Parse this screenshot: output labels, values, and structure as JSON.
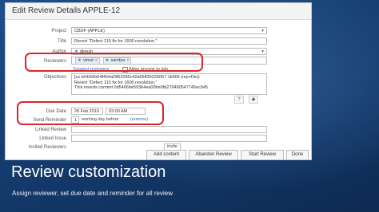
{
  "dialog": {
    "title": "Edit Review Details APPLE-12",
    "labels": {
      "project": "Project",
      "title": "Title",
      "author": "Author",
      "reviewers": "Reviewers",
      "objectives": "Objectives",
      "due_date": "Due Date",
      "send_reminder": "Send Reminder",
      "linked_review": "Linked Review",
      "linked_issue": "Linked Issue",
      "invited_reviewers": "Invited Reviewers"
    },
    "project_value": "CBDF (APPLE)",
    "title_value": "Revert \"Defect 115 fix for 1600 resolution.\"",
    "author_value": "dinesh",
    "reviewers": [
      "vimal",
      "sandya"
    ],
    "suggest_reviewers": "Suggest reviewers",
    "allow_anyone": "Allow anyone to join",
    "objectives_lines": [
      "[cs id=b55b64f464af3f62296c42a06ff39225067 1b506 |rep=Dio]:",
      "Revert \"Defect 115 fix for 1600 resolution.\"",
      "This reverts commit 0d5466be593b4ea00be0fd279490547745ec945"
    ],
    "due_date": "26 Feb 2019",
    "due_time": "03:00 AM",
    "reminder_count": "1",
    "reminder_text": "working day before",
    "reminder_remove": "(remove)",
    "invited_partial": "invite",
    "buttons": {
      "add_content": "Add content",
      "abandon_review": "Abandon Review",
      "start_review": "Start Review",
      "done": "Done"
    }
  },
  "slide": {
    "heading": "Review customization",
    "subtitle": "Assign reviewer, set due date and reminder for all review"
  }
}
